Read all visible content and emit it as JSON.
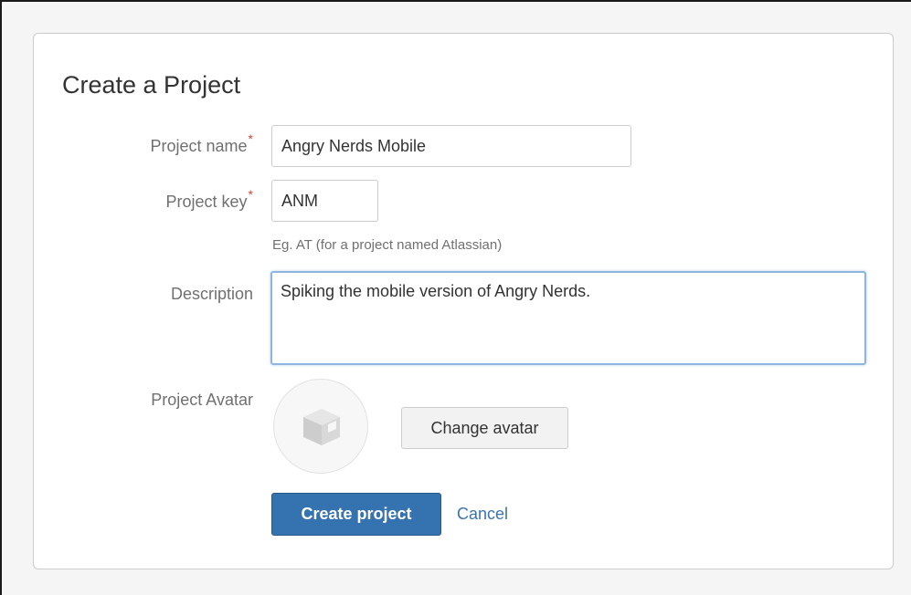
{
  "dialog": {
    "title": "Create a Project"
  },
  "form": {
    "project_name": {
      "label": "Project name",
      "required_mark": "*",
      "value": "Angry Nerds Mobile"
    },
    "project_key": {
      "label": "Project key",
      "required_mark": "*",
      "value": "ANM",
      "hint": "Eg. AT (for a project named Atlassian)"
    },
    "description": {
      "label": "Description",
      "value": "Spiking the mobile version of Angry Nerds."
    },
    "avatar": {
      "label": "Project Avatar",
      "icon": "box-icon",
      "change_label": "Change avatar"
    }
  },
  "actions": {
    "create_label": "Create project",
    "cancel_label": "Cancel"
  },
  "colors": {
    "primary": "#3572b0",
    "link": "#3b73af",
    "required": "#d04437",
    "focus": "#8fb4de"
  }
}
